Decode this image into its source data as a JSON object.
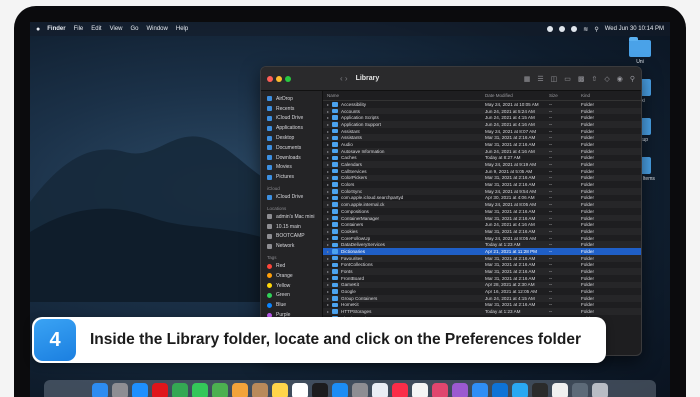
{
  "menubar": {
    "app": "Finder",
    "menus": [
      "File",
      "Edit",
      "View",
      "Go",
      "Window",
      "Help"
    ],
    "clock": "Wed Jun 30 10:14 PM"
  },
  "desktop_icons": [
    "Uni",
    "Wiki",
    "backup",
    "located Items"
  ],
  "finder": {
    "title": "Library",
    "sidebar": {
      "favorites": [
        "AirDrop",
        "Recents",
        "iCloud Drive",
        "Applications",
        "Desktop",
        "Documents",
        "Downloads",
        "Movies",
        "Pictures"
      ],
      "icloud_header": "iCloud",
      "icloud": [
        "iCloud Drive"
      ],
      "locations_header": "Locations",
      "locations": [
        "admin's Mac mini",
        "10.15 main",
        "BOOTCAMP",
        "Network"
      ],
      "tags_header": "Tags",
      "tags": [
        {
          "label": "Red",
          "color": "#ff453a"
        },
        {
          "label": "Orange",
          "color": "#ff9f0a"
        },
        {
          "label": "Yellow",
          "color": "#ffd60a"
        },
        {
          "label": "Green",
          "color": "#30d158"
        },
        {
          "label": "Blue",
          "color": "#0a84ff"
        },
        {
          "label": "Purple",
          "color": "#bf5af2"
        }
      ]
    },
    "columns": {
      "name": "Name",
      "date": "Date Modified",
      "size": "Size",
      "kind": "Kind"
    },
    "rows": [
      {
        "name": "Accessibility",
        "date": "May 24, 2021 at 10:05 AM",
        "size": "--",
        "kind": "Folder"
      },
      {
        "name": "Accounts",
        "date": "Jun 24, 2021 at 5:24 AM",
        "size": "--",
        "kind": "Folder"
      },
      {
        "name": "Application Scripts",
        "date": "Jun 24, 2021 at 4:15 AM",
        "size": "--",
        "kind": "Folder"
      },
      {
        "name": "Application Support",
        "date": "Jun 24, 2021 at 4:16 AM",
        "size": "--",
        "kind": "Folder"
      },
      {
        "name": "Assistant",
        "date": "May 24, 2021 at 8:07 AM",
        "size": "--",
        "kind": "Folder"
      },
      {
        "name": "Assistants",
        "date": "Mar 31, 2021 at 2:16 AM",
        "size": "--",
        "kind": "Folder"
      },
      {
        "name": "Audio",
        "date": "Mar 31, 2021 at 2:16 AM",
        "size": "--",
        "kind": "Folder"
      },
      {
        "name": "Autosave Information",
        "date": "Jun 24, 2021 at 4:16 AM",
        "size": "--",
        "kind": "Folder"
      },
      {
        "name": "Caches",
        "date": "Today at 8:27 AM",
        "size": "--",
        "kind": "Folder"
      },
      {
        "name": "Calendars",
        "date": "May 24, 2021 at 9:19 AM",
        "size": "--",
        "kind": "Folder"
      },
      {
        "name": "CallServices",
        "date": "Jun 9, 2021 at 5:05 AM",
        "size": "--",
        "kind": "Folder"
      },
      {
        "name": "ColorPickers",
        "date": "Mar 31, 2021 at 2:16 AM",
        "size": "--",
        "kind": "Folder"
      },
      {
        "name": "Colors",
        "date": "Mar 31, 2021 at 2:16 AM",
        "size": "--",
        "kind": "Folder"
      },
      {
        "name": "ColorSync",
        "date": "May 24, 2021 at 9:54 AM",
        "size": "--",
        "kind": "Folder"
      },
      {
        "name": "com.apple.icloud.searchpartyd",
        "date": "Apr 30, 2021 at 4:06 AM",
        "size": "--",
        "kind": "Folder"
      },
      {
        "name": "com.apple.internal.ck",
        "date": "May 24, 2021 at 8:05 AM",
        "size": "--",
        "kind": "Folder"
      },
      {
        "name": "Compositions",
        "date": "Mar 31, 2021 at 2:16 AM",
        "size": "--",
        "kind": "Folder"
      },
      {
        "name": "ContainerManager",
        "date": "Mar 31, 2021 at 2:16 AM",
        "size": "--",
        "kind": "Folder"
      },
      {
        "name": "Containers",
        "date": "Jun 24, 2021 at 4:16 AM",
        "size": "--",
        "kind": "Folder"
      },
      {
        "name": "Cookies",
        "date": "Mar 31, 2021 at 2:16 AM",
        "size": "--",
        "kind": "Folder"
      },
      {
        "name": "CoreFollowUp",
        "date": "May 24, 2021 at 8:05 AM",
        "size": "--",
        "kind": "Folder"
      },
      {
        "name": "DataDeliveryServices",
        "date": "Today at 1:23 AM",
        "size": "--",
        "kind": "Folder"
      },
      {
        "name": "Dictionaries",
        "date": "Apr 21, 2021 at 11:28 PM",
        "size": "--",
        "kind": "Folder"
      },
      {
        "name": "Favourites",
        "date": "Mar 31, 2021 at 2:16 AM",
        "size": "--",
        "kind": "Folder"
      },
      {
        "name": "FontCollections",
        "date": "Mar 31, 2021 at 2:16 AM",
        "size": "--",
        "kind": "Folder"
      },
      {
        "name": "Fonts",
        "date": "Mar 31, 2021 at 2:16 AM",
        "size": "--",
        "kind": "Folder"
      },
      {
        "name": "FrontBoard",
        "date": "Mar 31, 2021 at 2:16 AM",
        "size": "--",
        "kind": "Folder"
      },
      {
        "name": "GameKit",
        "date": "Apr 28, 2021 at 2:30 AM",
        "size": "--",
        "kind": "Folder"
      },
      {
        "name": "Google",
        "date": "Apr 16, 2021 at 12:05 AM",
        "size": "--",
        "kind": "Folder"
      },
      {
        "name": "Group Containers",
        "date": "Jun 24, 2021 at 4:15 AM",
        "size": "--",
        "kind": "Folder"
      },
      {
        "name": "HomeKit",
        "date": "Mar 31, 2021 at 2:16 AM",
        "size": "--",
        "kind": "Folder"
      },
      {
        "name": "HTTPStorages",
        "date": "Today at 1:23 AM",
        "size": "--",
        "kind": "Folder"
      },
      {
        "name": "IdentityServices",
        "date": "Mar 31, 2021 at 2:16 AM",
        "size": "--",
        "kind": "Folder"
      }
    ],
    "selected_row": "Dictionaries"
  },
  "dock": [
    {
      "name": "finder-app",
      "color": "#2d8cf0"
    },
    {
      "name": "launchpad-app",
      "color": "#8e8e93"
    },
    {
      "name": "safari-app",
      "color": "#1e90ff"
    },
    {
      "name": "opera-app",
      "color": "#e0151b"
    },
    {
      "name": "chrome-app",
      "color": "#34a853"
    },
    {
      "name": "messages-app",
      "color": "#34c759"
    },
    {
      "name": "maps-app",
      "color": "#4cb050"
    },
    {
      "name": "photos-app",
      "color": "#f2a33a"
    },
    {
      "name": "contacts-app",
      "color": "#b98a5a"
    },
    {
      "name": "notes-app",
      "color": "#ffd54a"
    },
    {
      "name": "reminders-app",
      "color": "#ffffff"
    },
    {
      "name": "tv-app",
      "color": "#1c1c1e"
    },
    {
      "name": "app-store-app",
      "color": "#1c8df5"
    },
    {
      "name": "system-preferences-app",
      "color": "#8e8e93"
    },
    {
      "name": "preview-app",
      "color": "#e9eef5"
    },
    {
      "name": "music-app",
      "color": "#fa2d48"
    },
    {
      "name": "textedit-app",
      "color": "#f5f5f5"
    },
    {
      "name": "photo-booth-app",
      "color": "#e0466e"
    },
    {
      "name": "podcasts-app",
      "color": "#9b59d0"
    },
    {
      "name": "mail-app",
      "color": "#2f8ef5"
    },
    {
      "name": "teamviewer-app",
      "color": "#0e73d6"
    },
    {
      "name": "mackeeper-app",
      "color": "#2aa8f2"
    },
    {
      "name": "terminal-app",
      "color": "#2b2b2b"
    },
    {
      "name": "document-app",
      "color": "#f0f0f0"
    },
    {
      "name": "downloads-stack",
      "color": "#5d6a78"
    },
    {
      "name": "trash-app",
      "color": "#b8bcc4"
    }
  ],
  "instruction": {
    "step": "4",
    "text": "Inside the Library folder, locate and click on the Preferences folder"
  }
}
